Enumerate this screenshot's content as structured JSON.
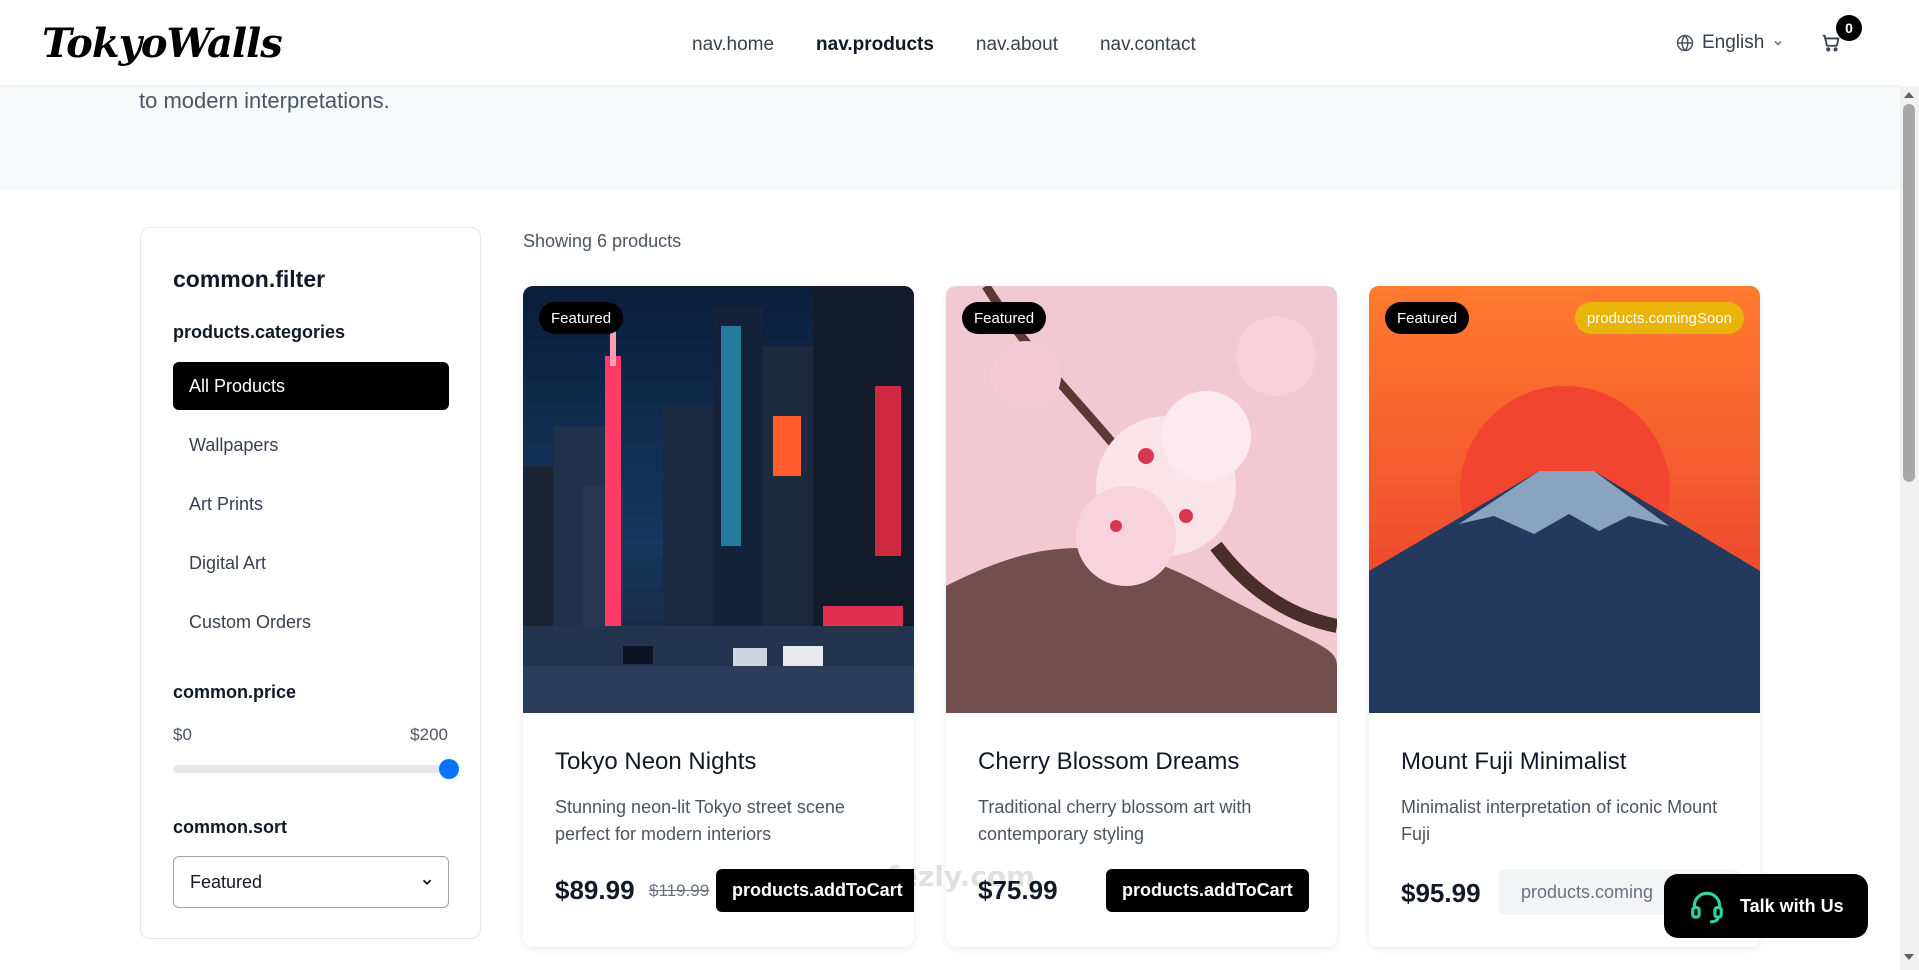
{
  "header": {
    "logo": "TokyoWalls",
    "nav": [
      {
        "label": "nav.home",
        "active": false
      },
      {
        "label": "nav.products",
        "active": true
      },
      {
        "label": "nav.about",
        "active": false
      },
      {
        "label": "nav.contact",
        "active": false
      }
    ],
    "language": "English",
    "cart_count": "0",
    "icons": {
      "language": "globe-icon",
      "dropdown": "chevron-down-icon",
      "cart": "cart-icon"
    }
  },
  "hero": {
    "text": "to modern interpretations."
  },
  "sidebar": {
    "title": "common.filter",
    "categories_title": "products.categories",
    "categories": [
      {
        "label": "All Products",
        "active": true
      },
      {
        "label": "Wallpapers",
        "active": false
      },
      {
        "label": "Art Prints",
        "active": false
      },
      {
        "label": "Digital Art",
        "active": false
      },
      {
        "label": "Custom Orders",
        "active": false
      }
    ],
    "price_title": "common.price",
    "price_min": "$0",
    "price_max": "$200",
    "price_slider_value": 1.0,
    "sort_title": "common.sort",
    "sort_value": "Featured"
  },
  "products": {
    "showing": "Showing 6 products",
    "items": [
      {
        "badge": "Featured",
        "title": "Tokyo Neon Nights",
        "desc": "Stunning neon-lit Tokyo street scene perfect for modern interiors",
        "price": "$89.99",
        "old_price": "$119.99",
        "action": "products.addToCart"
      },
      {
        "badge": "Featured",
        "title": "Cherry Blossom Dreams",
        "desc": "Traditional cherry blossom art with contemporary styling",
        "price": "$75.99",
        "action": "products.addToCart"
      },
      {
        "badge": "Featured",
        "badge2": "products.comingSoon",
        "title": "Mount Fuji Minimalist",
        "desc": "Minimalist interpretation of iconic Mount Fuji",
        "price": "$95.99",
        "action": "products.coming"
      }
    ]
  },
  "chat": {
    "label": "Talk with Us",
    "icon": "headset-icon"
  },
  "watermark": {
    "latin": "nafezly.com"
  },
  "colors": {
    "accent": "#0b74ff",
    "coming_soon": "#eab308",
    "primary": "#000000"
  }
}
